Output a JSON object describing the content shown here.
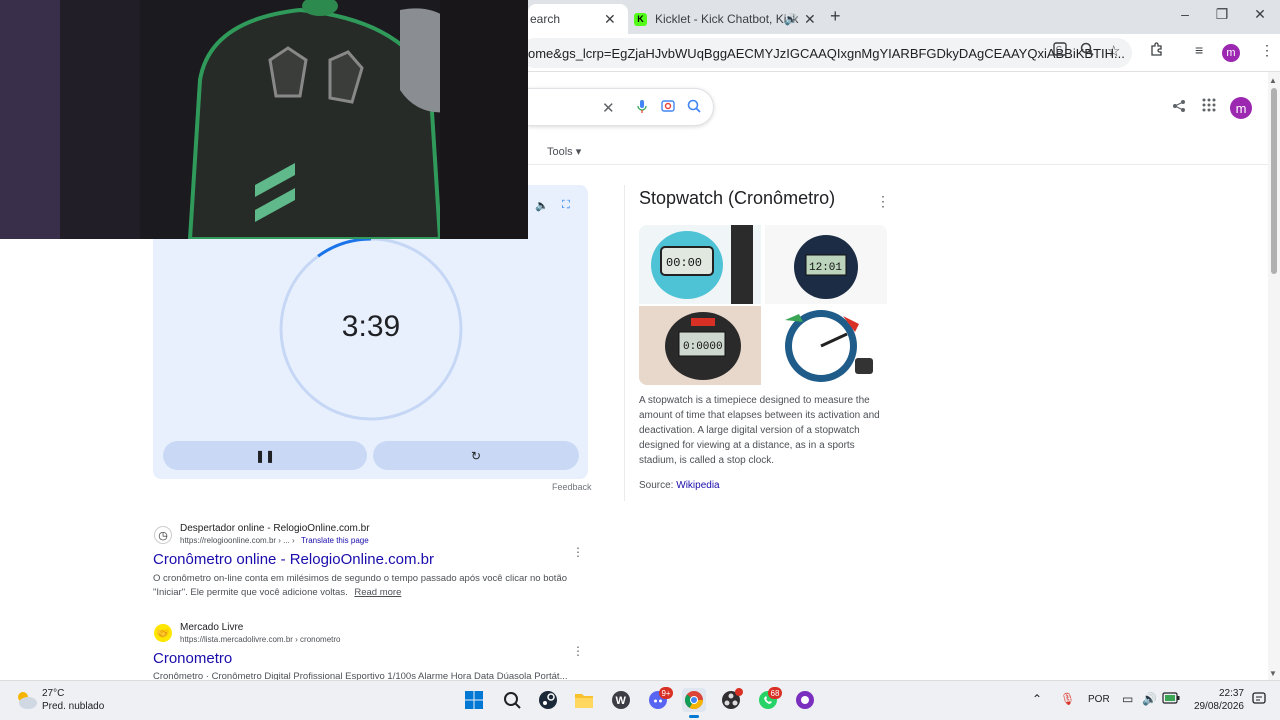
{
  "browser": {
    "tabs": [
      {
        "label": "earch",
        "active": true
      },
      {
        "label": "Kicklet - Kick Chatbot, Kick",
        "active": false
      }
    ],
    "address": "ome&gs_lcrp=EgZjaHJvbWUqBggAECMYJzIGCAAQIxgnMgYIARBFGDkyDAgCEAAYQxiABBiKBTIH...",
    "profile_initial": "m"
  },
  "page": {
    "tools_label": "Tools",
    "profile_initial": "m"
  },
  "stopwatch": {
    "time": "3:39",
    "progress_fraction": 0.1
  },
  "knowledge_panel": {
    "title": "Stopwatch (Cronômetro)",
    "description": "A stopwatch is a timepiece designed to measure the amount of time that elapses between its activation and deactivation. A large digital version of a stopwatch designed for viewing at a distance, as in a sports stadium, is called a stop clock.",
    "source_label": "Source:",
    "source_link": "Wikipedia"
  },
  "feedback_label": "Feedback",
  "results": [
    {
      "site": "Despertador online - RelogioOnline.com.br",
      "url": "https://relogioonline.com.br › ... › ",
      "translate": "Translate this page",
      "title": "Cronômetro online - RelogioOnline.com.br",
      "snippet_bold": "cronômetro",
      "snippet": "O cronômetro on-line conta em milésimos de segundo o tempo passado após você clicar no botão \"Iniciar\". Ele permite que você adicione voltas.",
      "read_more": "Read more"
    },
    {
      "site": "Mercado Livre",
      "url": "https://lista.mercadolivre.com.br › cronometro",
      "title": "Cronometro",
      "snippet": "Cronômetro · Cronômetro Digital Profissional Esportivo 1/100s Alarme Hora Data Dúasola Portát..."
    }
  ],
  "taskbar": {
    "weather_temp": "27°C",
    "weather_desc": "Pred. nublado",
    "lang": "POR",
    "time": "22:37",
    "date": "29/08/2026",
    "badges": {
      "discord": "9+",
      "whatsapp": "68"
    }
  }
}
